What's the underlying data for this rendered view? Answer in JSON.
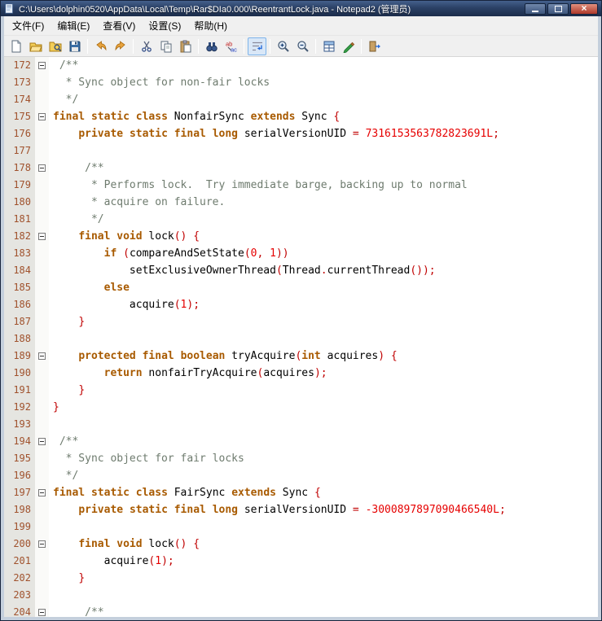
{
  "window": {
    "title": "C:\\Users\\dolphin0520\\AppData\\Local\\Temp\\Rar$DIa0.000\\ReentrantLock.java - Notepad2 (管理员)",
    "controls": [
      "minimize",
      "maximize",
      "close"
    ]
  },
  "menu_bar": {
    "items": [
      {
        "id": "file",
        "label": "文件(F)"
      },
      {
        "id": "edit",
        "label": "编辑(E)"
      },
      {
        "id": "view",
        "label": "查看(V)"
      },
      {
        "id": "settings",
        "label": "设置(S)"
      },
      {
        "id": "help",
        "label": "帮助(H)"
      }
    ]
  },
  "toolbar": {
    "buttons": [
      {
        "name": "new-file"
      },
      {
        "name": "open-file"
      },
      {
        "name": "browse-file"
      },
      {
        "name": "save-file"
      },
      {
        "separator": true
      },
      {
        "name": "undo"
      },
      {
        "name": "redo"
      },
      {
        "separator": true
      },
      {
        "name": "cut"
      },
      {
        "name": "copy"
      },
      {
        "name": "paste"
      },
      {
        "separator": true
      },
      {
        "name": "find"
      },
      {
        "name": "replace"
      },
      {
        "separator": true
      },
      {
        "name": "word-wrap",
        "active": true
      },
      {
        "separator": true
      },
      {
        "name": "zoom-in"
      },
      {
        "name": "zoom-out"
      },
      {
        "separator": true
      },
      {
        "name": "view-schemes"
      },
      {
        "name": "customize-schemes"
      },
      {
        "separator": true
      },
      {
        "name": "exit"
      }
    ]
  },
  "colors": {
    "keyword": "#A85A00",
    "comment": "#6E7B6E",
    "number": "#E60000",
    "operator": "#C00000",
    "line-number": "#A0522D",
    "gutter-bg": "#E5E5E1",
    "fold-bg": "#FAFAF8",
    "titlebar-top": "#44608C",
    "titlebar-bottom": "#1B2C4A",
    "toolbar-bg": "#F0F0F0",
    "active-button-bg": "#D9E7F7",
    "active-button-border": "#7EB4EA"
  },
  "editor": {
    "language": "Java",
    "lines": [
      {
        "num": "172",
        "fold": true,
        "segments": [
          [
            "c",
            " /**"
          ]
        ]
      },
      {
        "num": "173",
        "fold": false,
        "segments": [
          [
            "c",
            "  * Sync object for non-fair locks"
          ]
        ]
      },
      {
        "num": "174",
        "fold": false,
        "segments": [
          [
            "c",
            "  */"
          ]
        ]
      },
      {
        "num": "175",
        "fold": true,
        "segments": [
          [
            "k",
            "final"
          ],
          [
            "p",
            " "
          ],
          [
            "k",
            "static"
          ],
          [
            "p",
            " "
          ],
          [
            "k",
            "class"
          ],
          [
            "p",
            " NonfairSync "
          ],
          [
            "k",
            "extends"
          ],
          [
            "p",
            " Sync "
          ],
          [
            "o",
            "{"
          ]
        ]
      },
      {
        "num": "176",
        "fold": false,
        "segments": [
          [
            "p",
            "    "
          ],
          [
            "k",
            "private"
          ],
          [
            "p",
            " "
          ],
          [
            "k",
            "static"
          ],
          [
            "p",
            " "
          ],
          [
            "k",
            "final"
          ],
          [
            "p",
            " "
          ],
          [
            "k",
            "long"
          ],
          [
            "p",
            " serialVersionUID "
          ],
          [
            "o",
            "="
          ],
          [
            "p",
            " "
          ],
          [
            "n",
            "7316153563782823691L"
          ],
          [
            "o",
            ";"
          ]
        ]
      },
      {
        "num": "177",
        "fold": false,
        "segments": []
      },
      {
        "num": "178",
        "fold": true,
        "segments": [
          [
            "c",
            "     /**"
          ]
        ]
      },
      {
        "num": "179",
        "fold": false,
        "segments": [
          [
            "c",
            "      * Performs lock.  Try immediate barge, backing up to normal"
          ]
        ]
      },
      {
        "num": "180",
        "fold": false,
        "segments": [
          [
            "c",
            "      * acquire on failure."
          ]
        ]
      },
      {
        "num": "181",
        "fold": false,
        "segments": [
          [
            "c",
            "      */"
          ]
        ]
      },
      {
        "num": "182",
        "fold": true,
        "segments": [
          [
            "p",
            "    "
          ],
          [
            "k",
            "final"
          ],
          [
            "p",
            " "
          ],
          [
            "k",
            "void"
          ],
          [
            "p",
            " lock"
          ],
          [
            "o",
            "()"
          ],
          [
            "p",
            " "
          ],
          [
            "o",
            "{"
          ]
        ]
      },
      {
        "num": "183",
        "fold": false,
        "segments": [
          [
            "p",
            "        "
          ],
          [
            "k",
            "if"
          ],
          [
            "p",
            " "
          ],
          [
            "o",
            "("
          ],
          [
            "p",
            "compareAndSetState"
          ],
          [
            "o",
            "("
          ],
          [
            "n",
            "0"
          ],
          [
            "o",
            ","
          ],
          [
            "p",
            " "
          ],
          [
            "n",
            "1"
          ],
          [
            "o",
            "))"
          ]
        ]
      },
      {
        "num": "184",
        "fold": false,
        "segments": [
          [
            "p",
            "            setExclusiveOwnerThread"
          ],
          [
            "o",
            "("
          ],
          [
            "p",
            "Thread"
          ],
          [
            "o",
            "."
          ],
          [
            "p",
            "currentThread"
          ],
          [
            "o",
            "());"
          ]
        ]
      },
      {
        "num": "185",
        "fold": false,
        "segments": [
          [
            "p",
            "        "
          ],
          [
            "k",
            "else"
          ]
        ]
      },
      {
        "num": "186",
        "fold": false,
        "segments": [
          [
            "p",
            "            acquire"
          ],
          [
            "o",
            "("
          ],
          [
            "n",
            "1"
          ],
          [
            "o",
            ");"
          ]
        ]
      },
      {
        "num": "187",
        "fold": false,
        "segments": [
          [
            "p",
            "    "
          ],
          [
            "o",
            "}"
          ]
        ]
      },
      {
        "num": "188",
        "fold": false,
        "segments": []
      },
      {
        "num": "189",
        "fold": true,
        "segments": [
          [
            "p",
            "    "
          ],
          [
            "k",
            "protected"
          ],
          [
            "p",
            " "
          ],
          [
            "k",
            "final"
          ],
          [
            "p",
            " "
          ],
          [
            "k",
            "boolean"
          ],
          [
            "p",
            " tryAcquire"
          ],
          [
            "o",
            "("
          ],
          [
            "k",
            "int"
          ],
          [
            "p",
            " acquires"
          ],
          [
            "o",
            ")"
          ],
          [
            "p",
            " "
          ],
          [
            "o",
            "{"
          ]
        ]
      },
      {
        "num": "190",
        "fold": false,
        "segments": [
          [
            "p",
            "        "
          ],
          [
            "k",
            "return"
          ],
          [
            "p",
            " nonfairTryAcquire"
          ],
          [
            "o",
            "("
          ],
          [
            "p",
            "acquires"
          ],
          [
            "o",
            ");"
          ]
        ]
      },
      {
        "num": "191",
        "fold": false,
        "segments": [
          [
            "p",
            "    "
          ],
          [
            "o",
            "}"
          ]
        ]
      },
      {
        "num": "192",
        "fold": false,
        "segments": [
          [
            "o",
            "}"
          ]
        ]
      },
      {
        "num": "193",
        "fold": false,
        "segments": []
      },
      {
        "num": "194",
        "fold": true,
        "segments": [
          [
            "c",
            " /**"
          ]
        ]
      },
      {
        "num": "195",
        "fold": false,
        "segments": [
          [
            "c",
            "  * Sync object for fair locks"
          ]
        ]
      },
      {
        "num": "196",
        "fold": false,
        "segments": [
          [
            "c",
            "  */"
          ]
        ]
      },
      {
        "num": "197",
        "fold": true,
        "segments": [
          [
            "k",
            "final"
          ],
          [
            "p",
            " "
          ],
          [
            "k",
            "static"
          ],
          [
            "p",
            " "
          ],
          [
            "k",
            "class"
          ],
          [
            "p",
            " FairSync "
          ],
          [
            "k",
            "extends"
          ],
          [
            "p",
            " Sync "
          ],
          [
            "o",
            "{"
          ]
        ]
      },
      {
        "num": "198",
        "fold": false,
        "segments": [
          [
            "p",
            "    "
          ],
          [
            "k",
            "private"
          ],
          [
            "p",
            " "
          ],
          [
            "k",
            "static"
          ],
          [
            "p",
            " "
          ],
          [
            "k",
            "final"
          ],
          [
            "p",
            " "
          ],
          [
            "k",
            "long"
          ],
          [
            "p",
            " serialVersionUID "
          ],
          [
            "o",
            "="
          ],
          [
            "p",
            " "
          ],
          [
            "n",
            "-3000897897090466540L"
          ],
          [
            "o",
            ";"
          ]
        ]
      },
      {
        "num": "199",
        "fold": false,
        "segments": []
      },
      {
        "num": "200",
        "fold": true,
        "segments": [
          [
            "p",
            "    "
          ],
          [
            "k",
            "final"
          ],
          [
            "p",
            " "
          ],
          [
            "k",
            "void"
          ],
          [
            "p",
            " lock"
          ],
          [
            "o",
            "()"
          ],
          [
            "p",
            " "
          ],
          [
            "o",
            "{"
          ]
        ]
      },
      {
        "num": "201",
        "fold": false,
        "segments": [
          [
            "p",
            "        acquire"
          ],
          [
            "o",
            "("
          ],
          [
            "n",
            "1"
          ],
          [
            "o",
            ");"
          ]
        ]
      },
      {
        "num": "202",
        "fold": false,
        "segments": [
          [
            "p",
            "    "
          ],
          [
            "o",
            "}"
          ]
        ]
      },
      {
        "num": "203",
        "fold": false,
        "segments": []
      },
      {
        "num": "204",
        "fold": true,
        "segments": [
          [
            "c",
            "     /**"
          ]
        ]
      }
    ]
  }
}
